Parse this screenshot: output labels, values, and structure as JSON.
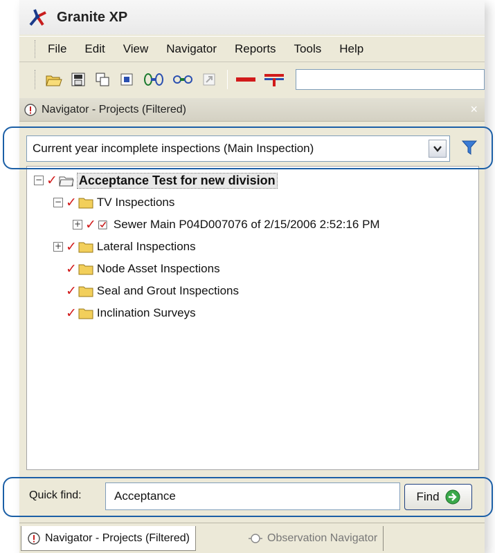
{
  "app": {
    "title": "Granite XP",
    "logo_icon": "granite-xp-logo"
  },
  "menu": {
    "items": [
      {
        "label": "File"
      },
      {
        "label": "Edit"
      },
      {
        "label": "View"
      },
      {
        "label": "Navigator"
      },
      {
        "label": "Reports"
      },
      {
        "label": "Tools"
      },
      {
        "label": "Help"
      }
    ]
  },
  "toolbar": {
    "icons": [
      "open-folder-icon",
      "save-icon",
      "copy-icon",
      "properties-icon",
      "connect-icon",
      "link-icon",
      "disabled-export-icon",
      "red-line-icon",
      "pipe-junction-icon"
    ]
  },
  "panel": {
    "title": "Navigator - Projects (Filtered)",
    "close": "×"
  },
  "filter": {
    "selected": "Current year incomplete inspections (Main Inspection)"
  },
  "tree": {
    "root": {
      "label": "Acceptance Test for new division",
      "expander": "−"
    },
    "tv": {
      "label": "TV Inspections",
      "expander": "−"
    },
    "sewer": {
      "label": "Sewer Main P04D007076 of 2/15/2006 2:52:16 PM",
      "expander": "+"
    },
    "lateral": {
      "label": "Lateral Inspections",
      "expander": "+"
    },
    "node_asset": {
      "label": "Node Asset Inspections"
    },
    "seal": {
      "label": "Seal and Grout Inspections"
    },
    "inclination": {
      "label": "Inclination Surveys"
    },
    "check_glyph": "✓"
  },
  "quick_find": {
    "label": "Quick find:",
    "value": "Acceptance",
    "button": "Find"
  },
  "tabs": [
    {
      "label": "Navigator - Projects (Filtered)"
    },
    {
      "label": "Observation Navigator"
    }
  ],
  "colors": {
    "accent": "#1b5fa6",
    "check": "#d11a1a",
    "folder": "#f2cf5b"
  }
}
